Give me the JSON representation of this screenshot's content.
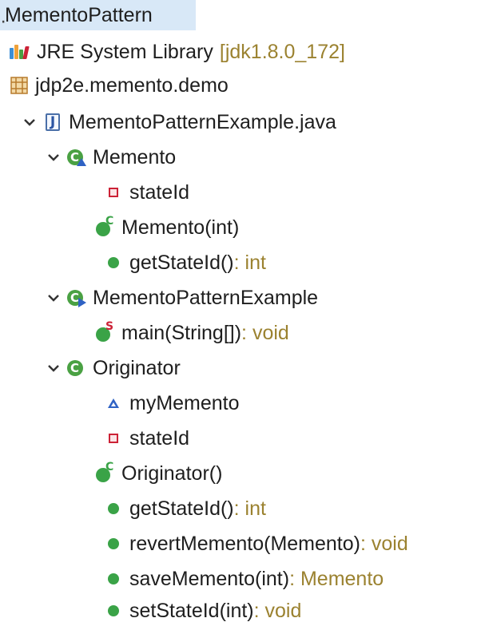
{
  "tree": {
    "root": "MementoPattern",
    "jre_label": "JRE System Library",
    "jre_version": "[jdk1.8.0_172]",
    "package": "jdp2e.memento.demo",
    "file": "MementoPatternExample.java",
    "class_memento": "Memento",
    "memento_field": "stateId",
    "memento_ctor": "Memento(int)",
    "memento_get": "getStateId()",
    "memento_get_type": " : int",
    "class_example": "MementoPatternExample",
    "main_method": "main(String[])",
    "main_type": " : void",
    "class_originator": "Originator",
    "orig_field1": "myMemento",
    "orig_field2": "stateId",
    "orig_ctor": "Originator()",
    "orig_get": "getStateId()",
    "orig_get_type": " : int",
    "orig_revert": "revertMemento(Memento)",
    "orig_revert_type": " : void",
    "orig_save": "saveMemento(int)",
    "orig_save_type": " : Memento",
    "orig_set": "setStateId(int)",
    "orig_set_type": " : void"
  },
  "icons": {
    "twisty": "chevron-down-icon",
    "library": "library-icon",
    "package": "package-icon",
    "java_file": "java-file-icon",
    "class": "class-icon",
    "private_field": "private-field-icon",
    "package_field": "package-field-icon",
    "constructor": "constructor-icon",
    "public_method": "public-method-icon",
    "static_method": "static-method-icon"
  },
  "colors": {
    "selection": "#d8e8f7",
    "type_hint": "#9b8230",
    "method_green": "#3aa347",
    "private_red": "#cc2236",
    "class_blue": "#2f62c4"
  }
}
